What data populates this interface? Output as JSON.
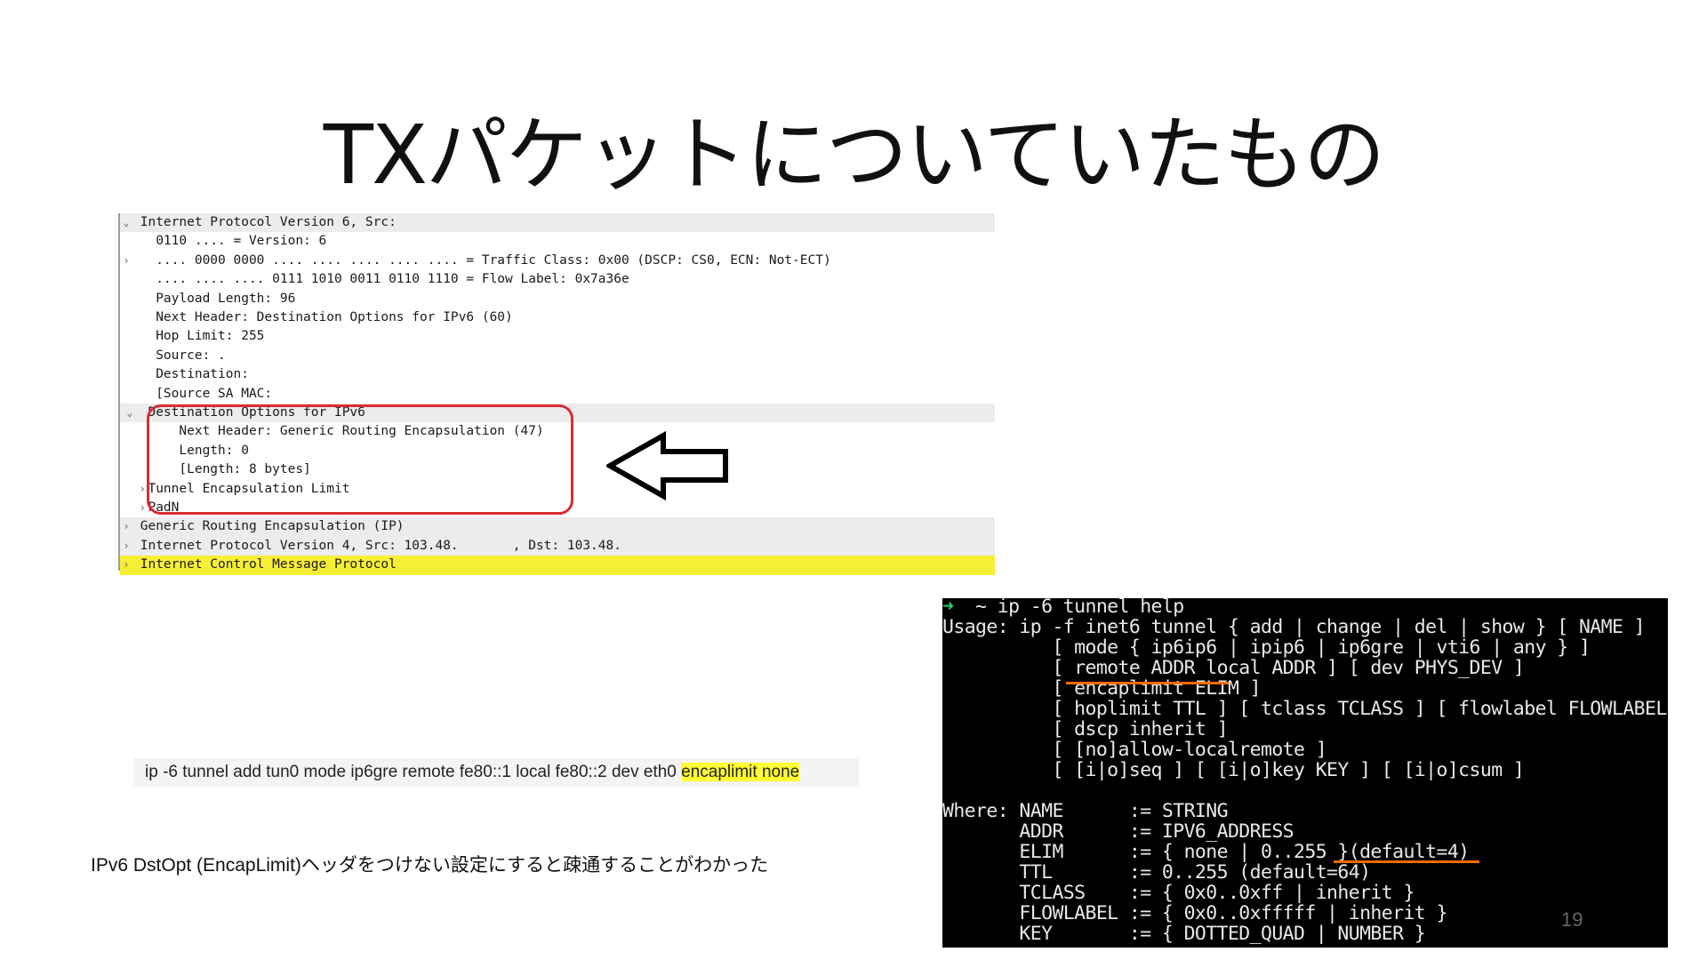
{
  "title": "TXパケットについていたもの",
  "wireshark": {
    "rows": [
      {
        "exp": "⌄",
        "text": "Internet Protocol Version 6, Src:"
      },
      {
        "exp": "",
        "text": "  0110 .... = Version: 6"
      },
      {
        "exp": "›",
        "text": "  .... 0000 0000 .... .... .... .... .... = Traffic Class: 0x00 (DSCP: CS0, ECN: Not-ECT)"
      },
      {
        "exp": "",
        "text": "  .... .... .... 0111 1010 0011 0110 1110 = Flow Label: 0x7a36e"
      },
      {
        "exp": "",
        "text": "  Payload Length: 96"
      },
      {
        "exp": "",
        "text": "  Next Header: Destination Options for IPv6 (60)"
      },
      {
        "exp": "",
        "text": "  Hop Limit: 255"
      },
      {
        "exp": "",
        "text": "  Source: ."
      },
      {
        "exp": "",
        "text": "  Destination:"
      },
      {
        "exp": "",
        "text": "  [Source SA MAC:"
      },
      {
        "exp": " ⌄",
        "text": " Destination Options for IPv6"
      },
      {
        "exp": "",
        "text": "     Next Header: Generic Routing Encapsulation (47)"
      },
      {
        "exp": "",
        "text": "     Length: 0"
      },
      {
        "exp": "",
        "text": "     [Length: 8 bytes]"
      },
      {
        "exp": "   ›",
        "text": " Tunnel Encapsulation Limit"
      },
      {
        "exp": "   ›",
        "text": " PadN"
      },
      {
        "exp": "›",
        "text": "Generic Routing Encapsulation (IP)"
      },
      {
        "exp": "›",
        "text": "Internet Protocol Version 4, Src: 103.48.       , Dst: 103.48."
      },
      {
        "exp": "›",
        "text": "Internet Control Message Protocol"
      }
    ]
  },
  "command": {
    "prefix": "ip -6 tunnel add tun0 mode ip6gre remote fe80::1 local fe80::2 dev eth0 ",
    "highlight": "encaplimit none"
  },
  "result_text": "IPv6 DstOpt (EncapLimit)ヘッダをつけない設定にすると疎通することがわかった",
  "terminal": {
    "prompt_symbol": "➜",
    "lines": [
      "  ~ ip -6 tunnel help",
      "Usage: ip -f inet6 tunnel { add | change | del | show } [ NAME ]",
      "          [ mode { ip6ip6 | ipip6 | ip6gre | vti6 | any } ]",
      "          [ remote ADDR local ADDR ] [ dev PHYS_DEV ]",
      "          [ encaplimit ELIM ]",
      "          [ hoplimit TTL ] [ tclass TCLASS ] [ flowlabel FLOWLABEL ]",
      "          [ dscp inherit ]",
      "          [ [no]allow-localremote ]",
      "          [ [i|o]seq ] [ [i|o]key KEY ] [ [i|o]csum ]",
      "",
      "Where: NAME      := STRING",
      "       ADDR      := IPV6_ADDRESS",
      "       ELIM      := { none | 0..255 }(default=4)",
      "       TTL       := 0..255 (default=64)",
      "       TCLASS    := { 0x0..0xff | inherit }",
      "       FLOWLABEL := { 0x0..0xfffff | inherit }",
      "       KEY       := { DOTTED_QUAD | NUMBER }"
    ]
  },
  "page_number": "19",
  "colors": {
    "highlight": "#f7ef35",
    "annotation_box": "#dc2b33",
    "underline": "#ff6a00",
    "prompt": "#23d160"
  }
}
